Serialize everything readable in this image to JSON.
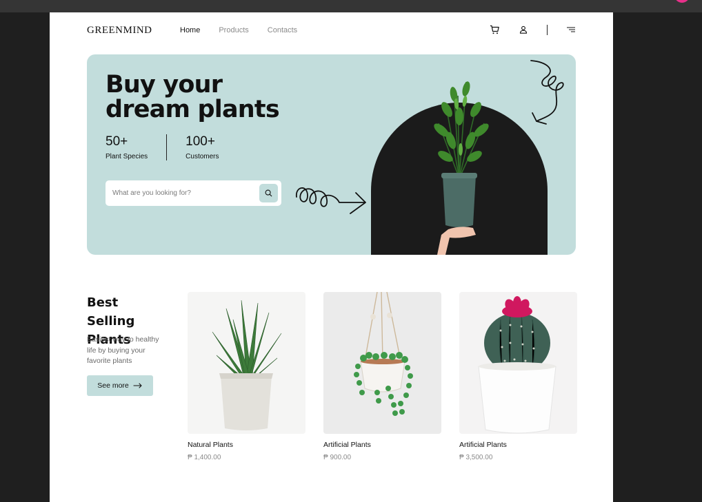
{
  "brand": {
    "logo": "GREENMIND"
  },
  "nav": {
    "links": [
      "Home",
      "Products",
      "Contacts"
    ],
    "active": "Home"
  },
  "nav_icons": [
    "cart-icon",
    "user-icon",
    "menu-icon"
  ],
  "hero": {
    "title_line1": "Buy your",
    "title_line2": "dream plants",
    "stats": [
      {
        "value": "50+",
        "label": "Plant Species"
      },
      {
        "value": "100+",
        "label": "Customers"
      }
    ],
    "search_placeholder": "What are you looking for?"
  },
  "best_selling": {
    "title": "Best Selling Plants",
    "description": "Easiest way to healthy life by buying your favorite plants",
    "button": "See more"
  },
  "products": [
    {
      "name": "Natural Plants",
      "price": "₱ 1,400.00"
    },
    {
      "name": "Artificial Plants",
      "price": "₱ 900.00"
    },
    {
      "name": "Artificial Plants",
      "price": "₱ 3,500.00"
    }
  ],
  "colors": {
    "accent": "#c2dddc",
    "dark": "#1b1b1b",
    "page": "#ffffff",
    "backdrop": "#1f1f1f",
    "badge": "#e8308a"
  }
}
